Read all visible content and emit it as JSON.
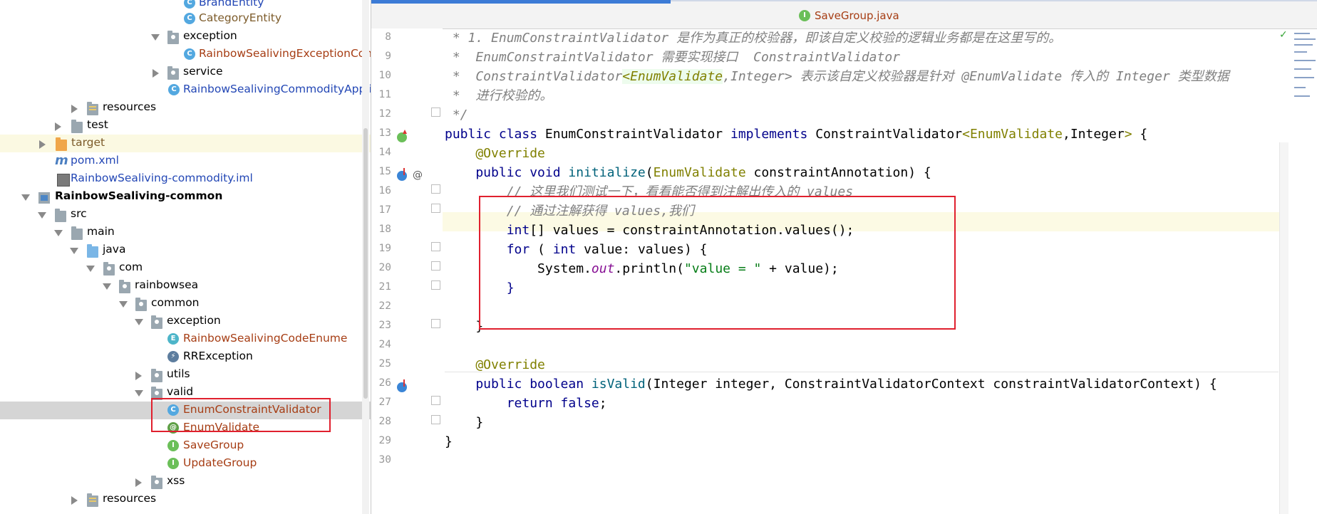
{
  "project_tree": {
    "rows": [
      {
        "label": "BrandEntity",
        "icon": "class-icon"
      },
      {
        "label": "CategoryEntity",
        "icon": "class-icon"
      },
      {
        "label": "exception",
        "icon": "package-icon"
      },
      {
        "label": "RainbowSealivingExceptionContr",
        "icon": "class-icon"
      },
      {
        "label": "service",
        "icon": "package-icon"
      },
      {
        "label": "RainbowSealivingCommodityApplic",
        "icon": "spring-boot-class-icon"
      },
      {
        "label": "resources",
        "icon": "resources-folder-icon"
      },
      {
        "label": "test",
        "icon": "folder-icon"
      },
      {
        "label": "target",
        "icon": "excluded-folder-icon"
      },
      {
        "label": "pom.xml",
        "icon": "maven-icon"
      },
      {
        "label": "RainbowSealiving-commodity.iml",
        "icon": "iml-file-icon"
      },
      {
        "label": "RainbowSealiving-common",
        "icon": "module-icon"
      },
      {
        "label": "src",
        "icon": "folder-icon"
      },
      {
        "label": "main",
        "icon": "folder-icon"
      },
      {
        "label": "java",
        "icon": "source-folder-icon"
      },
      {
        "label": "com",
        "icon": "package-icon"
      },
      {
        "label": "rainbowsea",
        "icon": "package-icon"
      },
      {
        "label": "common",
        "icon": "package-icon"
      },
      {
        "label": "exception",
        "icon": "package-icon"
      },
      {
        "label": "RainbowSealivingCodeEnume",
        "icon": "enum-icon"
      },
      {
        "label": "RRException",
        "icon": "exception-class-icon"
      },
      {
        "label": "utils",
        "icon": "package-icon"
      },
      {
        "label": "valid",
        "icon": "package-icon"
      },
      {
        "label": "EnumConstraintValidator",
        "icon": "class-icon"
      },
      {
        "label": "EnumValidate",
        "icon": "annotation-icon"
      },
      {
        "label": "SaveGroup",
        "icon": "interface-icon"
      },
      {
        "label": "UpdateGroup",
        "icon": "interface-icon"
      },
      {
        "label": "xss",
        "icon": "package-icon"
      },
      {
        "label": "resources",
        "icon": "resources-folder-icon"
      }
    ]
  },
  "editor": {
    "tab": {
      "label": "SaveGroup.java",
      "icon": "interface-icon"
    },
    "lines": [
      {
        "n": "8"
      },
      {
        "n": "9"
      },
      {
        "n": "10"
      },
      {
        "n": "11"
      },
      {
        "n": "12"
      },
      {
        "n": "13"
      },
      {
        "n": "14"
      },
      {
        "n": "15"
      },
      {
        "n": "16"
      },
      {
        "n": "17"
      },
      {
        "n": "18"
      },
      {
        "n": "19"
      },
      {
        "n": "20"
      },
      {
        "n": "21"
      },
      {
        "n": "22"
      },
      {
        "n": "23"
      },
      {
        "n": "24"
      },
      {
        "n": "25"
      },
      {
        "n": "26"
      },
      {
        "n": "27"
      },
      {
        "n": "28"
      },
      {
        "n": "29"
      },
      {
        "n": "30"
      }
    ],
    "code": {
      "l8": " * 1. EnumConstraintValidator 是作为真正的校验器，即该自定义校验的逻辑业务都是在这里写的。",
      "l9": " *  EnumConstraintValidator 需要实现接口  ConstraintValidator",
      "l10a": " *  ConstraintValidator",
      "l10b": "<EnumValidate",
      "l10c": ",Integer> 表示该自定义校验器是针对 @EnumValidate 传入的 Integer 类型数据",
      "l11": " *  进行校验的。",
      "l12": " */",
      "l13a": "public class",
      "l13b": " EnumConstraintValidator ",
      "l13c": "implements",
      "l13d": " ConstraintValidator",
      "l13e": "<EnumValidate",
      "l13f": ",Integer",
      "l13g": ">",
      "l13h": " {",
      "l14": "    @Override",
      "l15a": "    public void ",
      "l15b": "initialize",
      "l15c": "(",
      "l15d": "EnumValidate",
      "l15e": " constraintAnnotation) {",
      "l16": "        // 这里我们测试一下，看看能否得到注解出传入的 values",
      "l17": "        // 通过注解获得 values,我们",
      "l18a": "        int",
      "l18b": "[] values = constraintAnnotation.values();",
      "l19a": "        for",
      "l19b": " ( ",
      "l19c": "int",
      "l19d": " value: values) {",
      "l20a": "            System.",
      "l20b": "out",
      "l20c": ".println(",
      "l20d": "\"value = \"",
      "l20e": " + value);",
      "l21": "        }",
      "l22": "",
      "l23": "    }",
      "l24": "",
      "l25": "    @Override",
      "l26a": "    public boolean ",
      "l26b": "isValid",
      "l26c": "(Integer integer, ConstraintValidatorContext constraintValidatorContext) {",
      "l27a": "        return false",
      "l27b": ";",
      "l28": "    }",
      "l29": "}",
      "l30": ""
    }
  },
  "colors": {
    "keyword": "#00008b",
    "annotation": "#808000",
    "comment": "#808080",
    "string": "#067d17",
    "highlight_box": "#e0202e",
    "selected_row": "#d5d5d5"
  }
}
